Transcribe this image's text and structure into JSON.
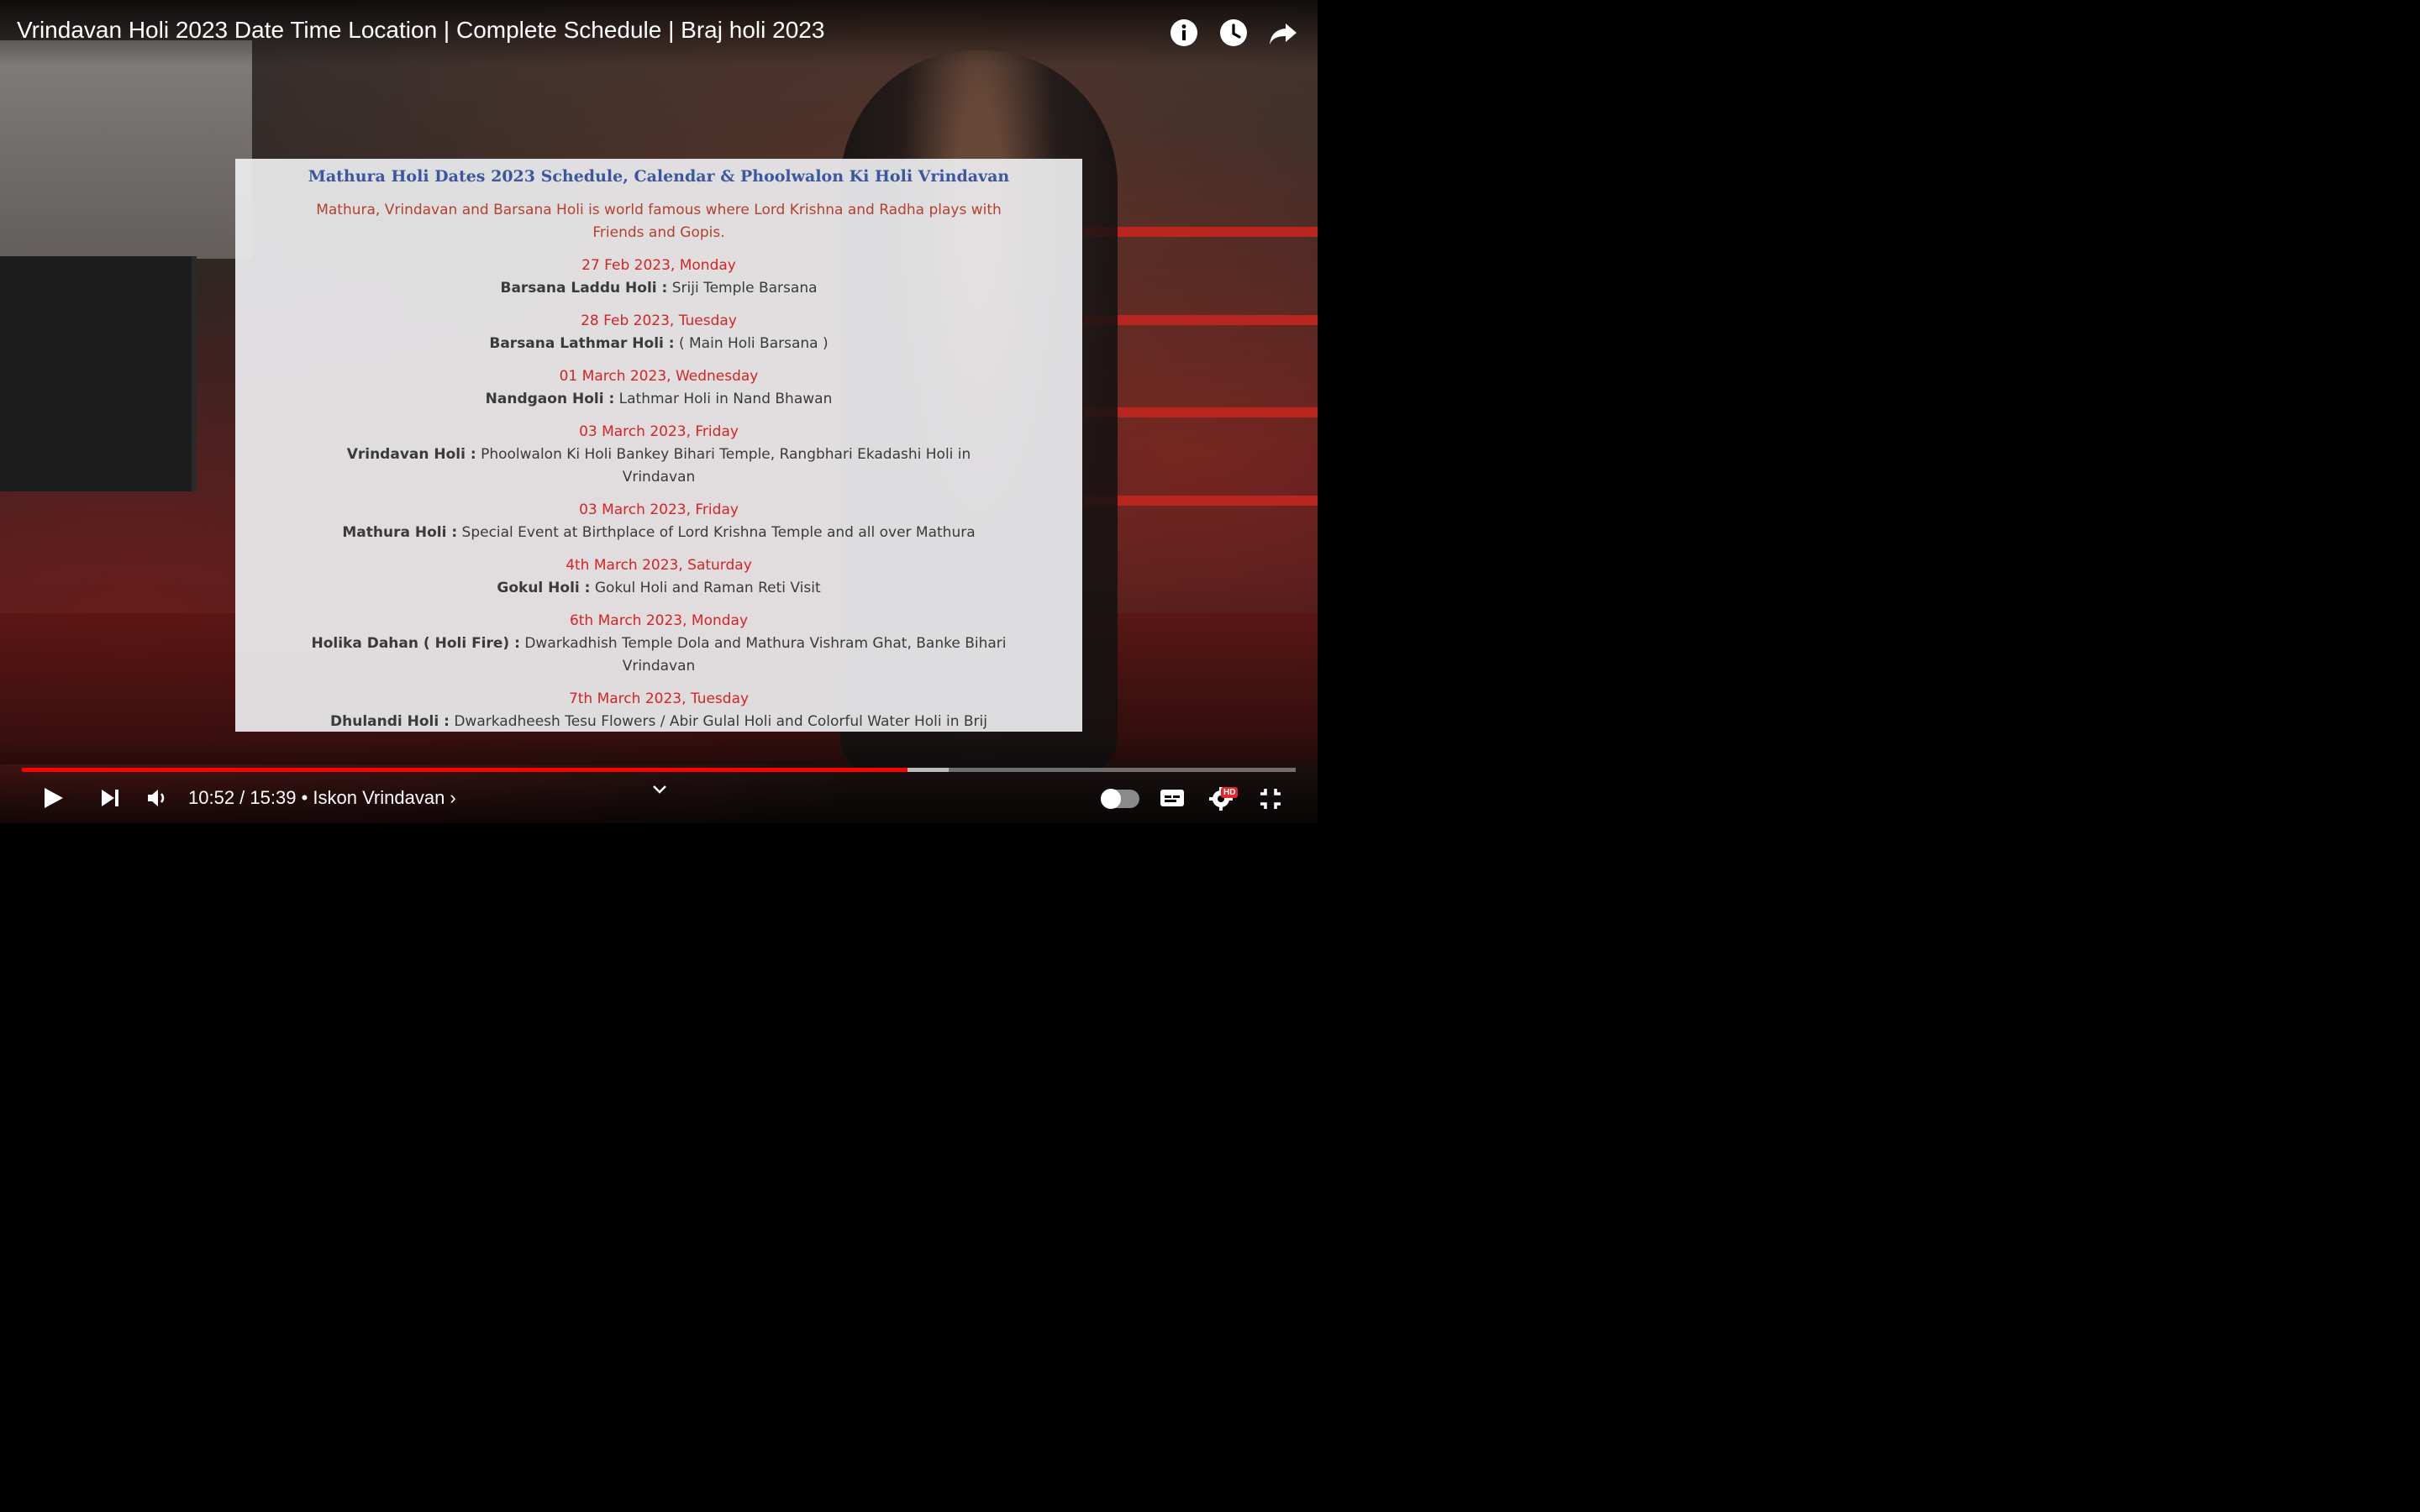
{
  "video": {
    "title": "Vrindavan Holi 2023 Date Time Location | Complete Schedule | Braj holi 2023"
  },
  "top_icons": [
    "info-icon",
    "clock-icon",
    "share-icon"
  ],
  "slide": {
    "title": "Mathura Holi Dates 2023 Schedule, Calendar & Phoolwalon Ki Holi Vrindavan",
    "intro": "Mathura, Vrindavan and Barsana Holi is world famous where Lord Krishna and Radha plays with Friends and Gopis.",
    "events": [
      {
        "date": "27 Feb 2023, Monday",
        "name": "Barsana Laddu Holi :",
        "detail": " Sriji Temple Barsana"
      },
      {
        "date": "28 Feb 2023, Tuesday",
        "name": "Barsana Lathmar Holi :",
        "detail": " ( Main Holi Barsana )"
      },
      {
        "date": "01 March 2023, Wednesday",
        "name": "Nandgaon Holi :",
        "detail": " Lathmar Holi in Nand Bhawan"
      },
      {
        "date": "03 March 2023, Friday",
        "name": "Vrindavan Holi :",
        "detail": " Phoolwalon Ki Holi Bankey Bihari Temple, Rangbhari Ekadashi Holi in Vrindavan"
      },
      {
        "date": "03 March 2023, Friday",
        "name": "Mathura Holi :",
        "detail": " Special Event at Birthplace of Lord Krishna Temple and all over Mathura"
      },
      {
        "date": "4th March 2023, Saturday",
        "name": "Gokul Holi :",
        "detail": " Gokul Holi and Raman Reti Visit"
      },
      {
        "date": "6th March 2023, Monday",
        "name": "Holika Dahan ( Holi Fire) :",
        "detail": " Dwarkadhish Temple Dola and Mathura Vishram Ghat, Banke Bihari Vrindavan"
      },
      {
        "date": "7th March 2023, Tuesday",
        "name": "Dhulandi Holi :",
        "detail": " Dwarkadheesh Tesu Flowers / Abir Gulal Holi and Colorful Water Holi in Brij"
      }
    ]
  },
  "player": {
    "time": "10:52 / 15:39",
    "channel": " • Iskon Vrindavan ›",
    "progress_fraction": 0.6953,
    "played_color": "#ff0000",
    "buffered_color": "#bdbdbd",
    "unplayed_color": "#6e6e6e",
    "hd_badge": "HD",
    "icons": [
      "play-icon",
      "next-icon",
      "volume-icon",
      "chevron-down-icon",
      "autoplay-toggle",
      "captions-icon",
      "settings-icon",
      "exit-fullscreen-icon"
    ]
  }
}
